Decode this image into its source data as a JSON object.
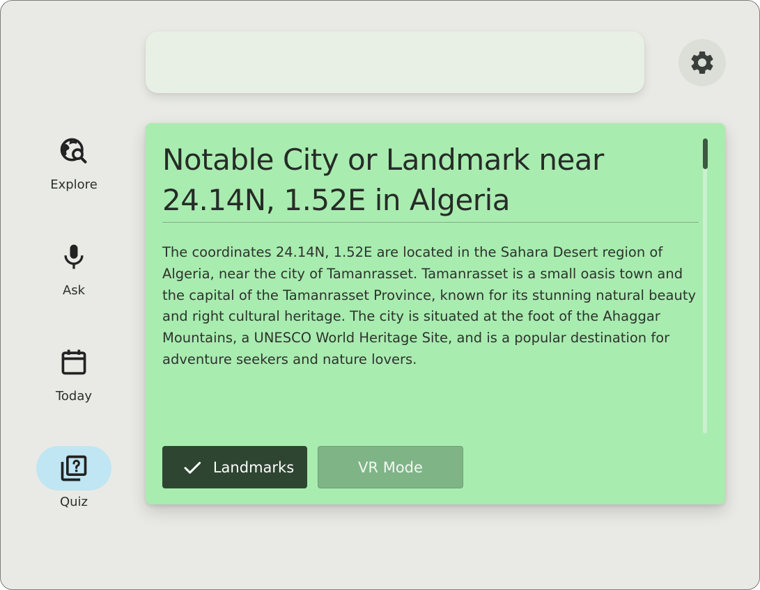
{
  "search": {
    "value": ""
  },
  "settings": {
    "icon": "gear-icon"
  },
  "nav": {
    "items": [
      {
        "label": "Explore",
        "icon": "globe-search-icon",
        "active": false
      },
      {
        "label": "Ask",
        "icon": "microphone-icon",
        "active": false
      },
      {
        "label": "Today",
        "icon": "calendar-icon",
        "active": false
      },
      {
        "label": "Quiz",
        "icon": "quiz-icon",
        "active": true
      }
    ]
  },
  "card": {
    "title": "Notable City or Landmark near 24.14N, 1.52E in Algeria",
    "body": "The coordinates 24.14N, 1.52E are located in the Sahara Desert region of Algeria, near the city of Tamanrasset. Tamanrasset is a small oasis town and the capital of the Tamanrasset Province, known for its stunning natural beauty and right cultural heritage. The city is situated at the foot of the Ahaggar Mountains, a UNESCO World Heritage Site, and is a popular destination for adventure seekers and nature lovers.",
    "chips": {
      "landmarks": {
        "label": "Landmarks",
        "selected": true,
        "icon": "check-icon"
      },
      "vr_mode": {
        "label": "VR Mode",
        "selected": false
      }
    }
  },
  "colors": {
    "background": "#e9eae5",
    "card": "#a9ecb0",
    "selected_chip": "#2e4532",
    "unselected_chip": "#7fb487",
    "active_nav": "#bfe6f2"
  }
}
